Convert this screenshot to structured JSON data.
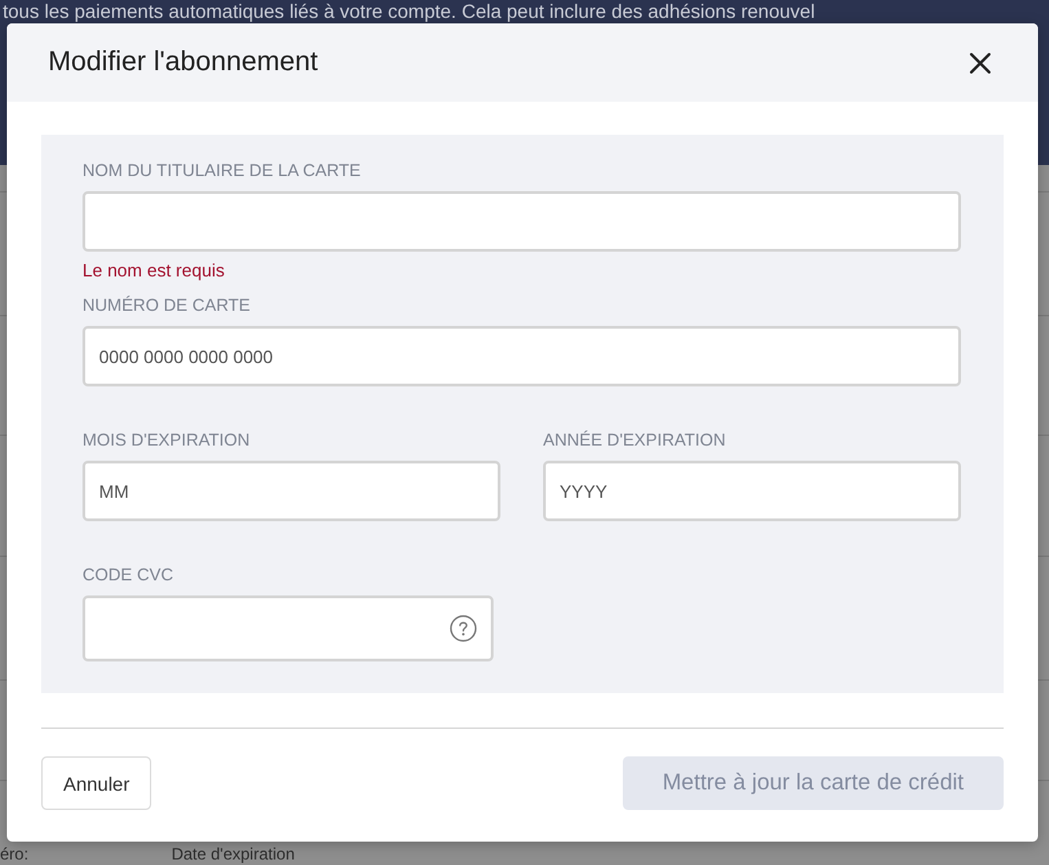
{
  "background": {
    "banner_text": "tous les paiements automatiques liés à votre compte. Cela peut inclure des adhésions renouvel",
    "bottom_texts": [
      "éro:",
      "Date d'expiration"
    ]
  },
  "dialog": {
    "title": "Modifier l'abonnement",
    "rows": [
      {
        "fields": [
          {
            "kind": "text",
            "label": "NOM DU TITULAIRE DE LA CARTE",
            "error": "Le nom est requis"
          }
        ]
      },
      {
        "fields": [
          {
            "kind": "text",
            "label": "NUMÉRO DE CARTE",
            "placeholder": "0000 0000 0000 0000"
          }
        ]
      },
      {
        "fields": [
          {
            "kind": "text",
            "label": "MOIS D'EXPIRATION",
            "placeholder": "MM"
          },
          {
            "kind": "text",
            "label": "ANNÉE D'EXPIRATION",
            "placeholder": "YYYY"
          }
        ]
      },
      {
        "fields": [
          {
            "kind": "help",
            "label": "CODE CVC"
          }
        ]
      }
    ],
    "buttons": [
      {
        "kind": "secondary",
        "label": "Annuler",
        "disabled": false
      },
      {
        "kind": "primary",
        "label": "Mettre à jour la carte de crédit",
        "disabled": true
      }
    ]
  }
}
